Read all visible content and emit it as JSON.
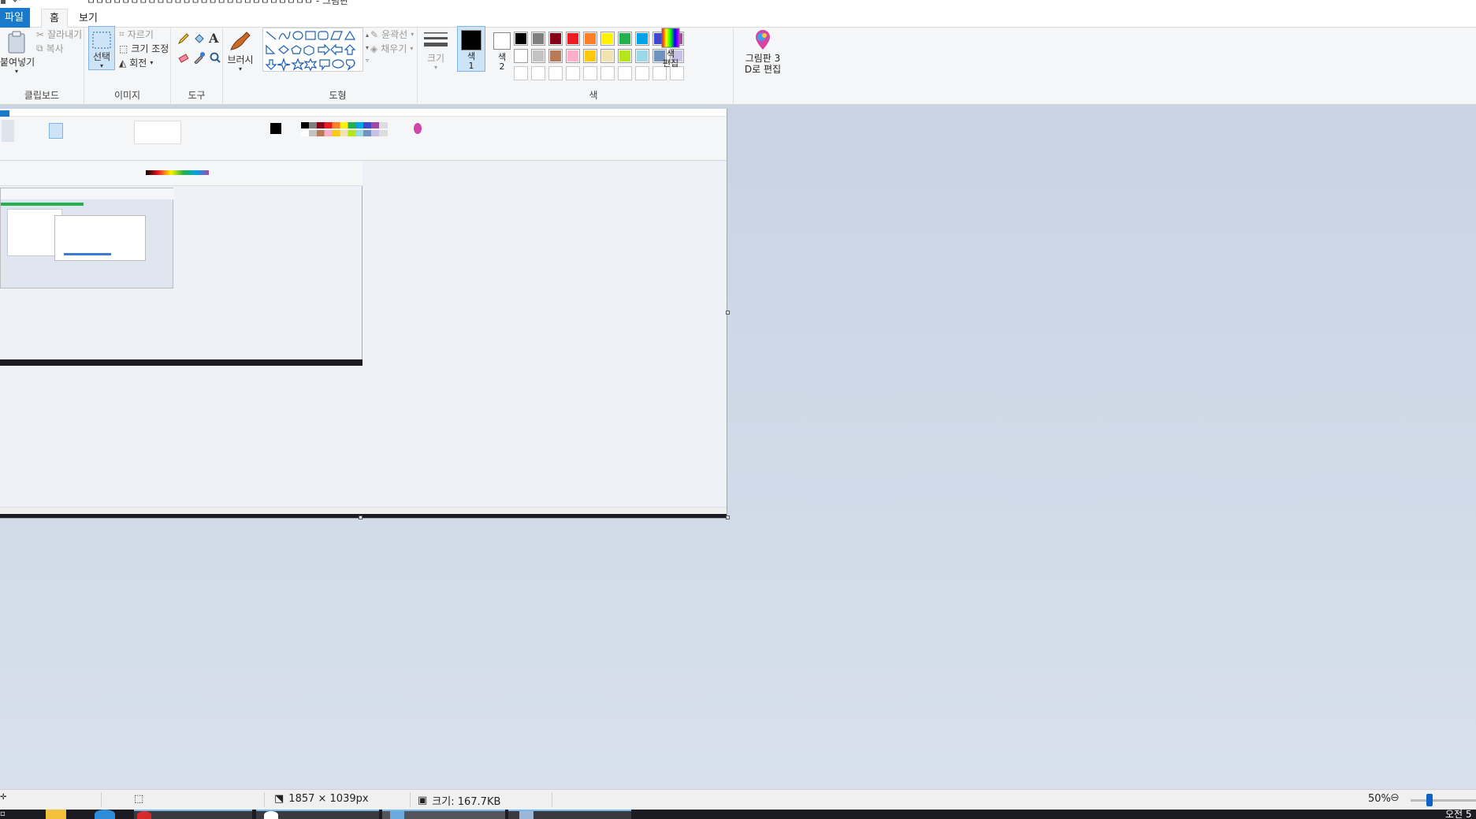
{
  "window": {
    "title": "ㅁㅁㅁㅁㅁㅁㅁㅁㅁㅁㅁㅁㅁㅁㅁㅁㅁㅁㅁㅁㅁㅁㅁㅁㅁㅁ - 그림판"
  },
  "tabs": {
    "file": "파일",
    "home": "홈",
    "view": "보기"
  },
  "ribbon": {
    "clipboard": {
      "label": "클립보드",
      "paste": "붙여넣기",
      "cut": "잘라내기",
      "copy": "복사"
    },
    "image": {
      "label": "이미지",
      "select": "선택",
      "crop": "자르기",
      "resize": "크기 조정",
      "rotate": "회전"
    },
    "tools": {
      "label": "도구"
    },
    "brushes": {
      "label": "브러시"
    },
    "shapes": {
      "label": "도형",
      "outline": "윤곽선",
      "fill": "채우기"
    },
    "size": {
      "label": "크기"
    },
    "colors": {
      "label": "색",
      "color1": "색\n1",
      "color2": "색\n2",
      "edit_colors": "색\n편집",
      "paint3d": "그림판 3\nD로 편집",
      "color1_value": "#000000",
      "color2_value": "#ffffff",
      "palette_row1": [
        "#000000",
        "#7f7f7f",
        "#880015",
        "#ed1c24",
        "#ff7f27",
        "#fff200",
        "#22b14c",
        "#00a2e8",
        "#3f48cc",
        "#a349a4"
      ],
      "palette_row2": [
        "#ffffff",
        "#c3c3c3",
        "#b97a57",
        "#ffaec9",
        "#ffc90e",
        "#efe4b0",
        "#b5e61d",
        "#99d9ea",
        "#7092be",
        "#c8bfe7"
      ]
    }
  },
  "statusbar": {
    "dimensions": "1857 × 1039px",
    "size": "크기: 167.7KB",
    "zoom": "50%"
  },
  "taskbar": {
    "clock": "오전 5"
  }
}
